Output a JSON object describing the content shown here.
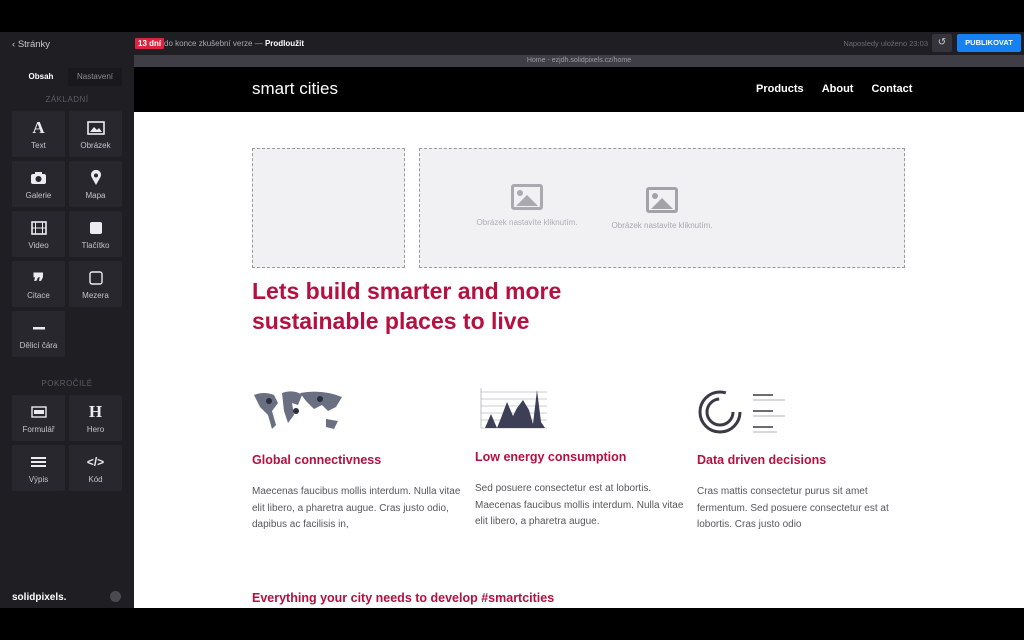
{
  "sidebar": {
    "back_label": "Stránky",
    "tabs": [
      {
        "label": "Obsah",
        "active": true
      },
      {
        "label": "Nastavení",
        "active": false
      }
    ],
    "basic_section": "ZÁKLADNÍ",
    "basic_items": [
      {
        "label": "Text",
        "icon": "text-icon"
      },
      {
        "label": "Obrázek",
        "icon": "image-icon"
      },
      {
        "label": "Galerie",
        "icon": "camera-icon"
      },
      {
        "label": "Mapa",
        "icon": "map-pin-icon"
      },
      {
        "label": "Video",
        "icon": "film-icon"
      },
      {
        "label": "Tlačítko",
        "icon": "button-icon"
      },
      {
        "label": "Citace",
        "icon": "quote-icon"
      },
      {
        "label": "Mezera",
        "icon": "spacer-icon"
      },
      {
        "label": "Dělicí čára",
        "icon": "divider-icon"
      }
    ],
    "advanced_section": "POKROČILÉ",
    "advanced_items": [
      {
        "label": "Formulář",
        "icon": "form-icon"
      },
      {
        "label": "Hero",
        "icon": "heading-icon"
      },
      {
        "label": "Výpis",
        "icon": "list-icon"
      },
      {
        "label": "Kód",
        "icon": "code-icon"
      }
    ],
    "brand": "solidpixels."
  },
  "topbar": {
    "trial_badge": "13 dní",
    "trial_text": "do konce zkušební verze —",
    "trial_link": "Prodloužit",
    "saved_text": "Naposledy uloženo 23:03",
    "publish_label": "PUBLIKOVAT"
  },
  "url_bar": "Home - ezjdh.solidpixels.cz/home",
  "site": {
    "logo": "smart cities",
    "menu": [
      "Products",
      "About",
      "Contact"
    ],
    "image_placeholder_caption": "Obrázek nastavíte kliknutím.",
    "hero_title": "Lets build smarter and more sustainable places to live",
    "features": [
      {
        "title": "Global connectivness",
        "text": "Maecenas faucibus mollis interdum. Nulla vitae elit libero, a pharetra augue. Cras justo odio, dapibus ac facilisis in,"
      },
      {
        "title": "Low energy consumption",
        "text": "Sed posuere consectetur est at lobortis. Maecenas faucibus mollis interdum. Nulla vitae elit libero, a pharetra augue."
      },
      {
        "title": "Data driven decisions",
        "text": "Cras mattis consectetur purus sit amet fermentum. Sed posuere consectetur est at lobortis. Cras justo odio"
      }
    ],
    "bottom_title": "Everything your city needs to develop #smartcities"
  },
  "colors": {
    "accent": "#b5103f",
    "publish": "#1680f5",
    "trial": "#d7263d"
  }
}
